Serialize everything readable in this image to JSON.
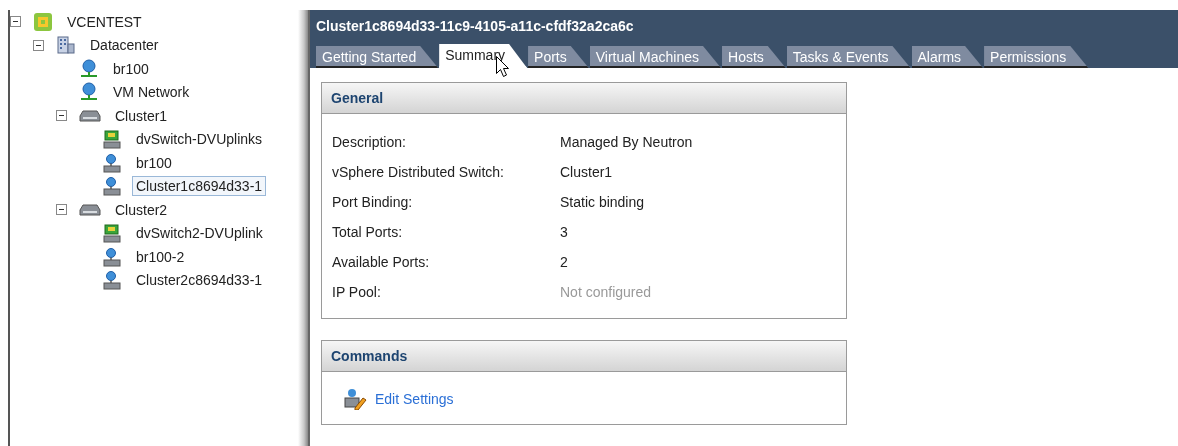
{
  "tree": [
    {
      "label": "VCENTEST",
      "kind": "vcenter",
      "expanded": true,
      "selected": false,
      "children": [
        {
          "label": "Datacenter",
          "kind": "datacenter",
          "expanded": true,
          "selected": false,
          "children": [
            {
              "label": "br100",
              "kind": "network",
              "selected": false
            },
            {
              "label": "VM Network",
              "kind": "network",
              "selected": false
            },
            {
              "label": "Cluster1",
              "kind": "cluster",
              "expanded": true,
              "selected": false,
              "children": [
                {
                  "label": "dvSwitch-DVUplinks",
                  "kind": "uplink",
                  "selected": false
                },
                {
                  "label": "br100",
                  "kind": "portgroup",
                  "selected": false
                },
                {
                  "label": "Cluster1c8694d33-1",
                  "kind": "portgroup",
                  "selected": true
                }
              ]
            },
            {
              "label": "Cluster2",
              "kind": "cluster",
              "expanded": true,
              "selected": false,
              "children": [
                {
                  "label": "dvSwitch2-DVUplink",
                  "kind": "uplink",
                  "selected": false
                },
                {
                  "label": "br100-2",
                  "kind": "portgroup",
                  "selected": false
                },
                {
                  "label": "Cluster2c8694d33-1",
                  "kind": "portgroup",
                  "selected": false
                }
              ]
            }
          ]
        }
      ]
    }
  ],
  "header": {
    "title": "Cluster1c8694d33-11c9-4105-a11c-cfdf32a2ca6c"
  },
  "tabs": [
    {
      "label": "Getting Started",
      "selected": false
    },
    {
      "label": "Summary",
      "selected": true
    },
    {
      "label": "Ports",
      "selected": false
    },
    {
      "label": "Virtual Machines",
      "selected": false
    },
    {
      "label": "Hosts",
      "selected": false
    },
    {
      "label": "Tasks & Events",
      "selected": false
    },
    {
      "label": "Alarms",
      "selected": false
    },
    {
      "label": "Permissions",
      "selected": false
    }
  ],
  "general": {
    "title": "General",
    "rows": [
      {
        "label": "Description:",
        "value": "Managed By Neutron",
        "muted": false
      },
      {
        "label": "vSphere Distributed Switch:",
        "value": "Cluster1",
        "muted": false
      },
      {
        "label": "Port Binding:",
        "value": "Static binding",
        "muted": false
      },
      {
        "label": "Total Ports:",
        "value": "3",
        "muted": false
      },
      {
        "label": "Available Ports:",
        "value": "2",
        "muted": false
      },
      {
        "label": "IP Pool:",
        "value": "Not configured",
        "muted": true
      }
    ]
  },
  "commands": {
    "title": "Commands",
    "items": [
      {
        "label": "Edit Settings"
      }
    ]
  }
}
